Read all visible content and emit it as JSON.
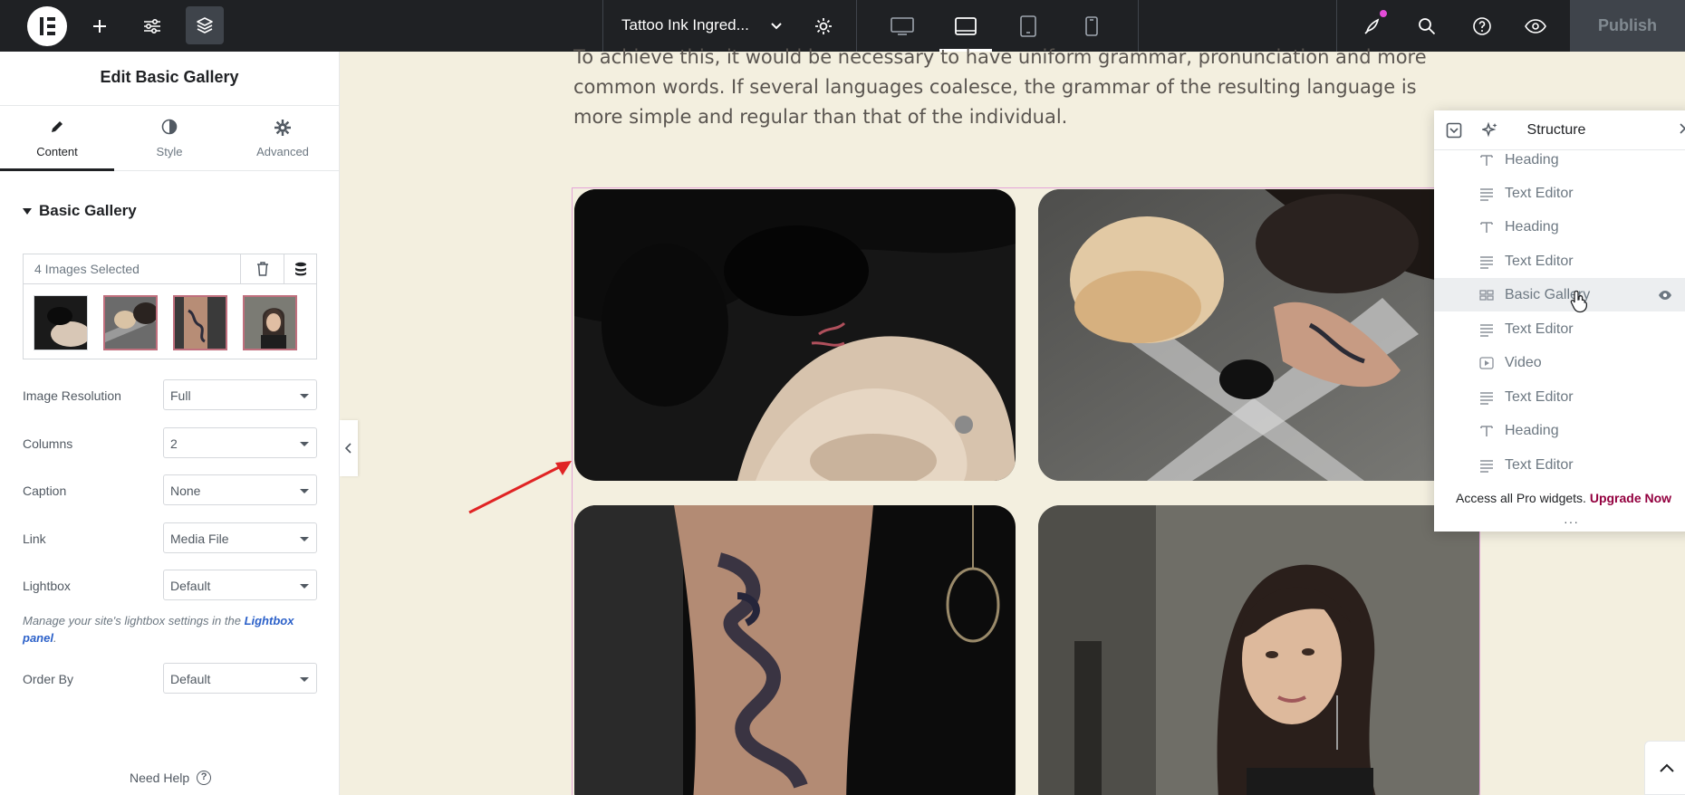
{
  "topbar": {
    "doc_title": "Tattoo Ink Ingred...",
    "publish_label": "Publish",
    "icons": [
      "elementor-logo-icon",
      "plus-icon",
      "sliders-icon",
      "layers-icon",
      "chevron-down-icon",
      "gear-icon",
      "desktop-icon",
      "tablet-landscape-icon",
      "tablet-icon",
      "mobile-icon",
      "rocket-icon",
      "search-icon",
      "help-icon",
      "eye-icon"
    ]
  },
  "panel": {
    "title": "Edit Basic Gallery",
    "tabs": [
      {
        "label": "Content",
        "icon": "pencil-icon"
      },
      {
        "label": "Style",
        "icon": "half-circle-icon"
      },
      {
        "label": "Advanced",
        "icon": "gear-icon"
      }
    ],
    "section": "Basic Gallery",
    "gallery_selected": "4 Images Selected",
    "controls": [
      {
        "label": "Image Resolution",
        "value": "Full"
      },
      {
        "label": "Columns",
        "value": "2"
      },
      {
        "label": "Caption",
        "value": "None"
      },
      {
        "label": "Link",
        "value": "Media File"
      },
      {
        "label": "Lightbox",
        "value": "Default"
      },
      {
        "label": "Order By",
        "value": "Default"
      }
    ],
    "note_text": "Manage your site's lightbox settings in the ",
    "note_link": "Lightbox panel",
    "note_end": ".",
    "need_help": "Need Help"
  },
  "canvas": {
    "intro_text": "To achieve this, it would be necessary to have uniform grammar, pronunciation and more common words. If several languages coalesce, the grammar of the resulting language is more simple and regular than that of the individual."
  },
  "structure": {
    "title": "Structure",
    "items": [
      {
        "label": "Heading",
        "icon": "heading-icon"
      },
      {
        "label": "Text Editor",
        "icon": "text-editor-icon"
      },
      {
        "label": "Heading",
        "icon": "heading-icon"
      },
      {
        "label": "Text Editor",
        "icon": "text-editor-icon"
      },
      {
        "label": "Basic Gallery",
        "icon": "gallery-icon",
        "active": true
      },
      {
        "label": "Text Editor",
        "icon": "text-editor-icon"
      },
      {
        "label": "Video",
        "icon": "video-icon"
      },
      {
        "label": "Text Editor",
        "icon": "text-editor-icon"
      },
      {
        "label": "Heading",
        "icon": "heading-icon"
      },
      {
        "label": "Text Editor",
        "icon": "text-editor-icon"
      }
    ],
    "footer_text": "Access all Pro widgets.",
    "footer_link": "Upgrade Now",
    "dots": "···"
  },
  "colors": {
    "topbar": "#1f2124",
    "canvas_bg": "#f3efdf",
    "upgrade": "#93003f",
    "selection_outline": "#e4a5d8",
    "arrow": "#e02424"
  }
}
